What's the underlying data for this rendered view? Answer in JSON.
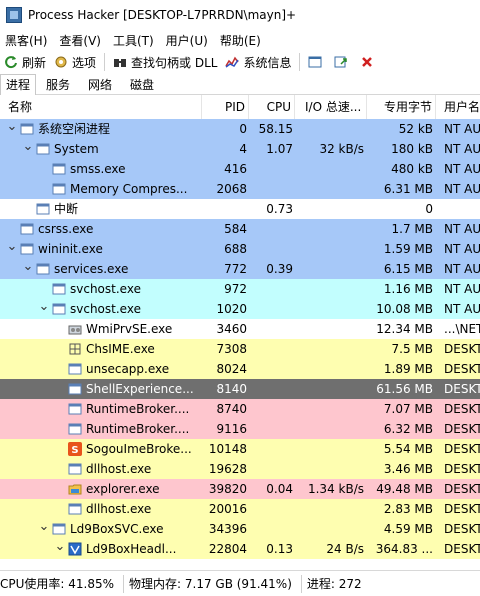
{
  "window": {
    "title": "Process Hacker [DESKTOP-L7PRRDN\\mayn]+"
  },
  "menu": [
    "黑客(H)",
    "查看(V)",
    "工具(T)",
    "用户(U)",
    "帮助(E)"
  ],
  "toolbar": {
    "refresh": "刷新",
    "options": "选项",
    "find_handles": "查找句柄或 DLL",
    "sysinfo": "系统信息"
  },
  "tabs": [
    "进程",
    "服务",
    "网络",
    "磁盘"
  ],
  "columns": {
    "name": "名称",
    "pid": "PID",
    "cpu": "CPU",
    "io": "I/O 总速...",
    "mem": "专用字节",
    "user": "用户名"
  },
  "colors": {
    "system": "#a6c8f8",
    "service": "#c2fefe",
    "own": "#fefeb0",
    "suspended": "#6f6f6f",
    "immersive": "#fec6ce",
    "gui": "#fefeb0",
    "blue_outline": "#e2e8f3"
  },
  "processes": [
    {
      "depth": 0,
      "arrow": "open",
      "icon": "window-icon",
      "name": "系统空闲进程",
      "pid": "0",
      "cpu": "58.15",
      "io": "",
      "mem": "52 kB",
      "user": "NT AU",
      "bg": "#a6c8f8"
    },
    {
      "depth": 1,
      "arrow": "open",
      "icon": "window-icon",
      "name": "System",
      "pid": "4",
      "cpu": "1.07",
      "io": "32 kB/s",
      "mem": "180 kB",
      "user": "NT AU",
      "bg": "#a6c8f8"
    },
    {
      "depth": 2,
      "arrow": "none",
      "icon": "window-icon",
      "name": "smss.exe",
      "pid": "416",
      "cpu": "",
      "io": "",
      "mem": "480 kB",
      "user": "NT AU",
      "bg": "#a6c8f8"
    },
    {
      "depth": 2,
      "arrow": "none",
      "icon": "window-icon",
      "name": "Memory Compres...",
      "pid": "2068",
      "cpu": "",
      "io": "",
      "mem": "6.31 MB",
      "user": "NT AU",
      "bg": "#a6c8f8"
    },
    {
      "depth": 1,
      "arrow": "none",
      "icon": "window-icon",
      "name": "中断",
      "pid": "",
      "cpu": "0.73",
      "io": "",
      "mem": "0",
      "user": "",
      "bg": "#ffffff"
    },
    {
      "depth": 0,
      "arrow": "none",
      "icon": "window-icon",
      "name": "csrss.exe",
      "pid": "584",
      "cpu": "",
      "io": "",
      "mem": "1.7 MB",
      "user": "NT AU",
      "bg": "#a6c8f8"
    },
    {
      "depth": 0,
      "arrow": "open",
      "icon": "window-icon",
      "name": "wininit.exe",
      "pid": "688",
      "cpu": "",
      "io": "",
      "mem": "1.59 MB",
      "user": "NT AU",
      "bg": "#a6c8f8"
    },
    {
      "depth": 1,
      "arrow": "open",
      "icon": "window-icon",
      "name": "services.exe",
      "pid": "772",
      "cpu": "0.39",
      "io": "",
      "mem": "6.15 MB",
      "user": "NT AU",
      "bg": "#a6c8f8"
    },
    {
      "depth": 2,
      "arrow": "none",
      "icon": "window-icon",
      "name": "svchost.exe",
      "pid": "972",
      "cpu": "",
      "io": "",
      "mem": "1.16 MB",
      "user": "NT AU",
      "bg": "#c2fefe"
    },
    {
      "depth": 2,
      "arrow": "open",
      "icon": "window-icon",
      "name": "svchost.exe",
      "pid": "1020",
      "cpu": "",
      "io": "",
      "mem": "10.08 MB",
      "user": "NT AU",
      "bg": "#c2fefe"
    },
    {
      "depth": 3,
      "arrow": "none",
      "icon": "gears-icon",
      "name": "WmiPrvSE.exe",
      "pid": "3460",
      "cpu": "",
      "io": "",
      "mem": "12.34 MB",
      "user": "...\\NET",
      "bg": "#ffffff"
    },
    {
      "depth": 3,
      "arrow": "none",
      "icon": "ime-icon",
      "name": "ChsIME.exe",
      "pid": "7308",
      "cpu": "",
      "io": "",
      "mem": "7.5 MB",
      "user": "DESKT",
      "bg": "#fefeb0"
    },
    {
      "depth": 3,
      "arrow": "none",
      "icon": "window-icon",
      "name": "unsecapp.exe",
      "pid": "8024",
      "cpu": "",
      "io": "",
      "mem": "1.89 MB",
      "user": "DESKT",
      "bg": "#fefeb0"
    },
    {
      "depth": 3,
      "arrow": "none",
      "icon": "window-icon",
      "name": "ShellExperience...",
      "pid": "8140",
      "cpu": "",
      "io": "",
      "mem": "61.56 MB",
      "user": "DESKT",
      "bg": "#6f6f6f"
    },
    {
      "depth": 3,
      "arrow": "none",
      "icon": "window-icon",
      "name": "RuntimeBroker....",
      "pid": "8740",
      "cpu": "",
      "io": "",
      "mem": "7.07 MB",
      "user": "DESKT",
      "bg": "#fec6ce"
    },
    {
      "depth": 3,
      "arrow": "none",
      "icon": "window-icon",
      "name": "RuntimeBroker....",
      "pid": "9116",
      "cpu": "",
      "io": "",
      "mem": "6.32 MB",
      "user": "DESKT",
      "bg": "#fec6ce"
    },
    {
      "depth": 3,
      "arrow": "none",
      "icon": "sogou-icon",
      "name": "SogouImeBroke...",
      "pid": "10148",
      "cpu": "",
      "io": "",
      "mem": "5.54 MB",
      "user": "DESKT",
      "bg": "#fefeb0"
    },
    {
      "depth": 3,
      "arrow": "none",
      "icon": "window-icon",
      "name": "dllhost.exe",
      "pid": "19628",
      "cpu": "",
      "io": "",
      "mem": "3.46 MB",
      "user": "DESKT",
      "bg": "#fefeb0"
    },
    {
      "depth": 3,
      "arrow": "none",
      "icon": "folder-icon",
      "name": "explorer.exe",
      "pid": "39820",
      "cpu": "0.04",
      "io": "1.34 kB/s",
      "mem": "49.48 MB",
      "user": "DESKT",
      "bg": "#fec6ce"
    },
    {
      "depth": 3,
      "arrow": "none",
      "icon": "window-icon",
      "name": "dllhost.exe",
      "pid": "20016",
      "cpu": "",
      "io": "",
      "mem": "2.83 MB",
      "user": "DESKT",
      "bg": "#fefeb0"
    },
    {
      "depth": 2,
      "arrow": "open",
      "icon": "window-icon",
      "name": "Ld9BoxSVC.exe",
      "pid": "34396",
      "cpu": "",
      "io": "",
      "mem": "4.59 MB",
      "user": "DESKT",
      "bg": "#fefeb0"
    },
    {
      "depth": 3,
      "arrow": "open",
      "icon": "ld-icon",
      "name": "Ld9BoxHeadl...",
      "pid": "22804",
      "cpu": "0.13",
      "io": "24 B/s",
      "mem": "364.83 ...",
      "user": "DESKT",
      "bg": "#fefeb0"
    }
  ],
  "status": {
    "cpu": "CPU使用率: 41.85%",
    "mem": "物理内存: 7.17 GB (91.41%)",
    "procs": "进程: 272"
  }
}
